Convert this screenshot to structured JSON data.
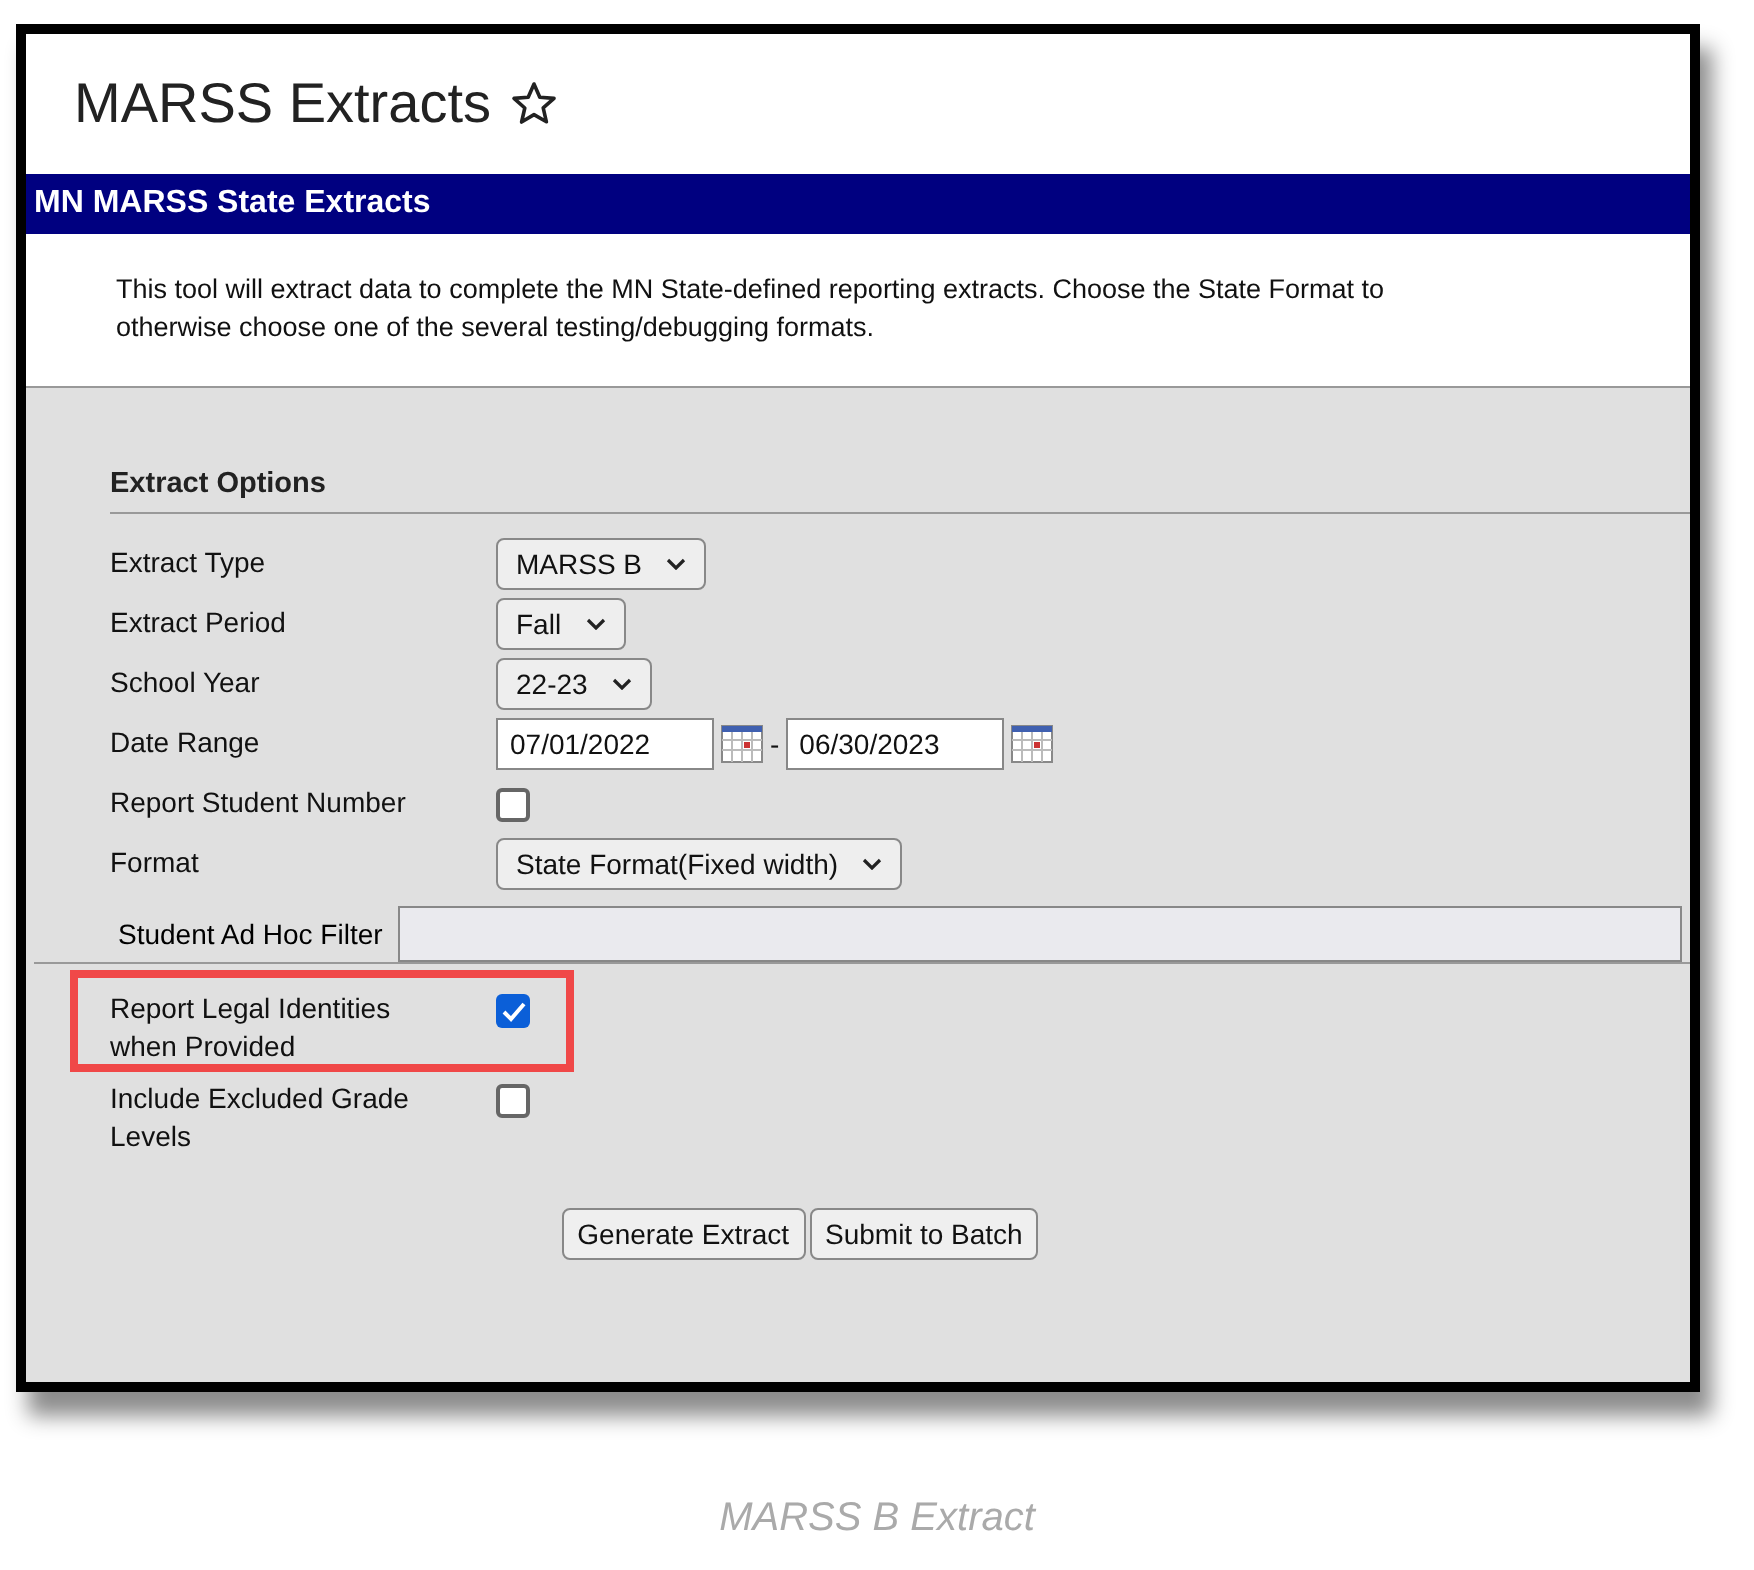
{
  "page": {
    "title": "MARSS Extracts",
    "favorite": false
  },
  "banner": "MN MARSS State Extracts",
  "description": "This tool will extract data to complete the MN State-defined reporting extracts. Choose the State Format to\notherwise choose one of the several testing/debugging formats.",
  "section": "Extract Options",
  "fields": [
    {
      "kind": "select",
      "label": "Extract Type",
      "value": "MARSS B"
    },
    {
      "kind": "select",
      "label": "Extract Period",
      "value": "Fall"
    },
    {
      "kind": "select",
      "label": "School Year",
      "value": "22-23"
    },
    {
      "kind": "date_range",
      "label": "Date Range",
      "start": "07/01/2022",
      "separator": "-",
      "end": "06/30/2023"
    },
    {
      "kind": "checkbox",
      "label": "Report Student Number",
      "checked": false,
      "highlighted": false
    },
    {
      "kind": "select",
      "label": "Format",
      "value": "State Format(Fixed width)"
    },
    {
      "kind": "filter",
      "label": "Student Ad Hoc Filter"
    },
    {
      "kind": "checkbox",
      "label": "Report Legal Identities when Provided",
      "checked": true,
      "highlighted": true
    },
    {
      "kind": "checkbox",
      "label": "Include Excluded Grade Levels",
      "checked": false,
      "highlighted": false
    }
  ],
  "buttons": [
    "Generate Extract",
    "Submit to Batch"
  ],
  "caption": "MARSS B Extract"
}
